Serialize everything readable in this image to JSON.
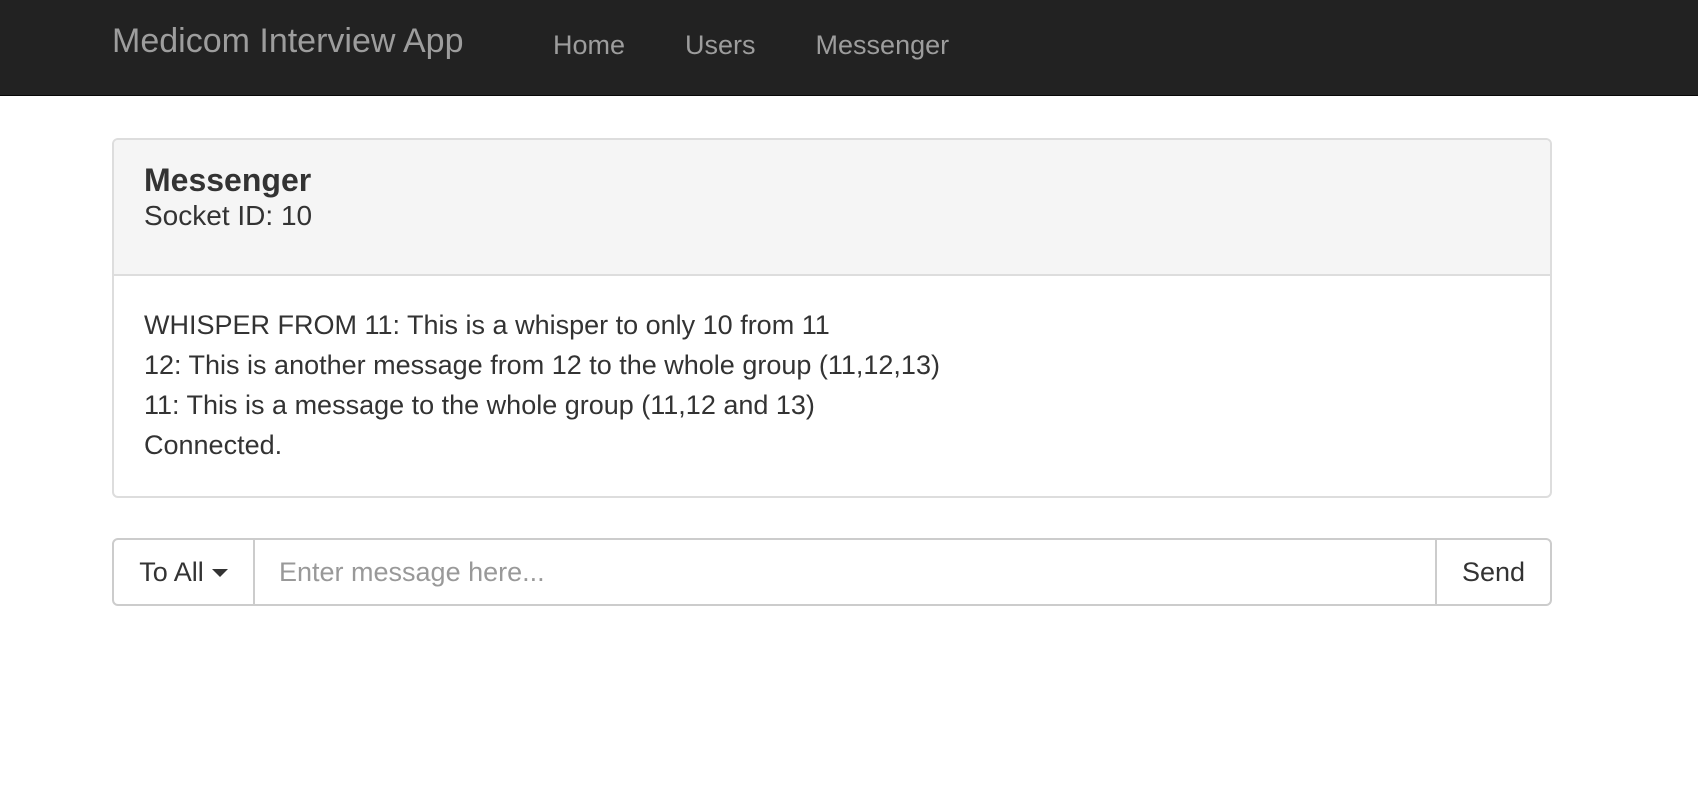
{
  "navbar": {
    "brand": "Medicom Interview App",
    "links": [
      {
        "label": "Home"
      },
      {
        "label": "Users"
      },
      {
        "label": "Messenger"
      }
    ]
  },
  "panel": {
    "title": "Messenger",
    "subtitle": "Socket ID: 10",
    "messages": [
      "WHISPER FROM 11: This is a whisper to only 10 from 11",
      "12: This is another message from 12 to the whole group (11,12,13)",
      "11: This is a message to the whole group (11,12 and 13)",
      "Connected."
    ]
  },
  "compose": {
    "recipient_label": "To All",
    "recipient_icon": "caret-down-icon",
    "input_value": "",
    "input_placeholder": "Enter message here...",
    "send_label": "Send"
  },
  "colors": {
    "navbar_bg": "#222222",
    "nav_text": "#9d9d9d",
    "panel_heading_bg": "#f5f5f5",
    "border": "#dddddd"
  }
}
